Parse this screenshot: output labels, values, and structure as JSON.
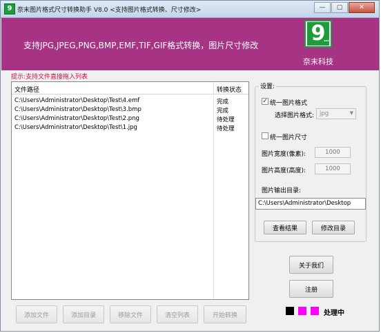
{
  "window": {
    "title": "奈末图片格式尺寸转换助手 V8.0   <支持图片格式转换、尺寸修改>",
    "icon_glyph": "9",
    "controls": {
      "minimize": "—",
      "maximize": "▢",
      "close": "✕"
    }
  },
  "banner": {
    "text": "支持JPG,JPEG,PNG,BMP,EMF,TIF,GIF格式转换，图片尺寸修改",
    "logo_glyph": "9",
    "logo_dots": "...",
    "company": "奈末科技",
    "color": "#a63383"
  },
  "hint": "提示:支持文件直接拖入列表",
  "list": {
    "columns": {
      "path": "文件路径",
      "status": "转换状态"
    },
    "rows": [
      {
        "path": "C:\\Users\\Administrator\\Desktop\\Test\\4.emf",
        "status": "完成"
      },
      {
        "path": "C:\\Users\\Administrator\\Desktop\\Test\\3.bmp",
        "status": "完成"
      },
      {
        "path": "C:\\Users\\Administrator\\Desktop\\Test\\2.png",
        "status": "待处理"
      },
      {
        "path": "C:\\Users\\Administrator\\Desktop\\Test\\1.jpg",
        "status": "待处理"
      }
    ]
  },
  "bottom_buttons": {
    "add_file": "添加文件",
    "add_dir": "添加目录",
    "remove_file": "移除文件",
    "clear_list": "清空列表",
    "start": "开始转换"
  },
  "settings": {
    "title": "设置:",
    "unify_format": {
      "label": "统一图片格式",
      "checked": true,
      "mark": "✓"
    },
    "select_format_label": "选择图片格式:",
    "format_value": "jpg",
    "unify_size": {
      "label": "统一图片尺寸",
      "checked": false
    },
    "width_label": "图片宽度(像素):",
    "width_value": "1000",
    "height_label": "图片高度(高度):",
    "height_value": "1000",
    "output_label": "图片输出目录:",
    "output_value": "C:\\Users\\Administrator\\Desktop",
    "view_result": "查看结果",
    "change_dir": "修改目录"
  },
  "right_buttons": {
    "about": "关于我们",
    "register": "注册"
  },
  "status": {
    "text": "处理中",
    "colors": [
      "#000000",
      "#ff00ff",
      "#ff00ff"
    ]
  }
}
